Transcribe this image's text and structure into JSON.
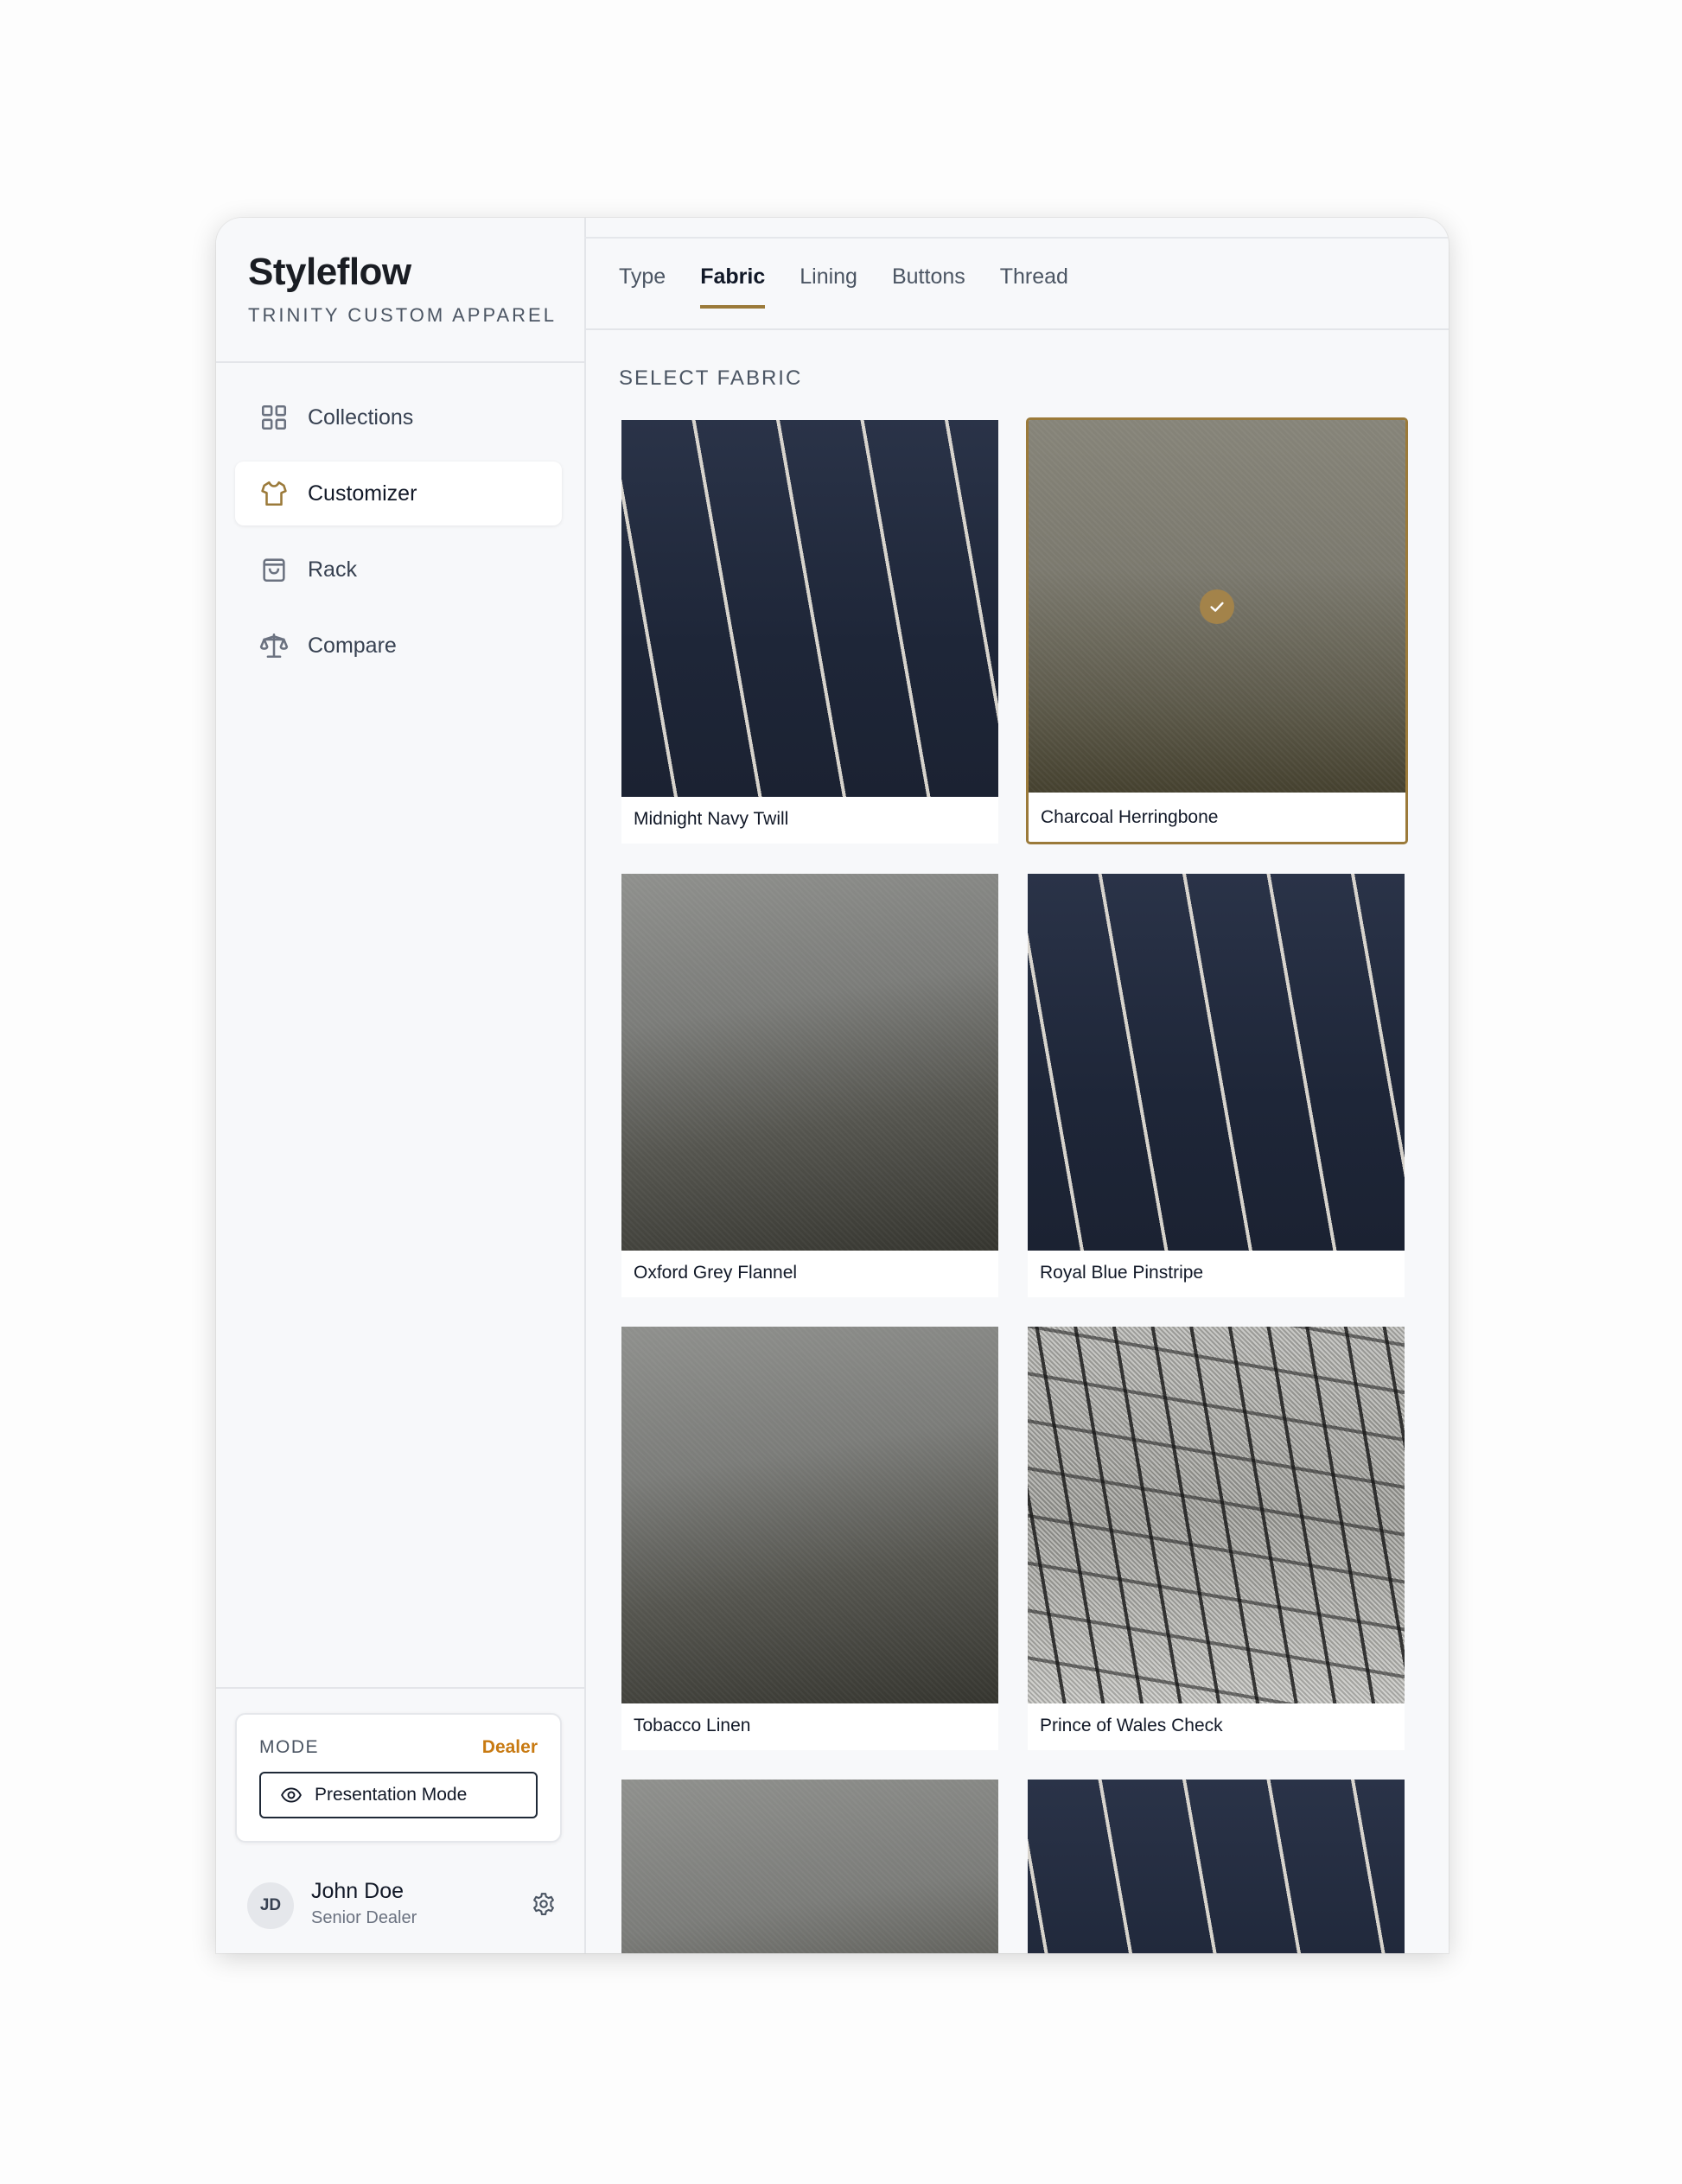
{
  "brand": {
    "title": "Styleflow",
    "subtitle": "TRINITY CUSTOM APPAREL"
  },
  "sidebar": {
    "items": [
      {
        "label": "Collections",
        "icon": "grid-icon",
        "active": false
      },
      {
        "label": "Customizer",
        "icon": "shirt-icon",
        "active": true
      },
      {
        "label": "Rack",
        "icon": "shopping-bag-icon",
        "active": false
      },
      {
        "label": "Compare",
        "icon": "scale-icon",
        "active": false
      }
    ]
  },
  "mode": {
    "label": "MODE",
    "value": "Dealer",
    "button_label": "Presentation Mode",
    "button_icon": "eye-icon"
  },
  "user": {
    "initials": "JD",
    "name": "John Doe",
    "role": "Senior Dealer",
    "settings_icon": "gear-icon"
  },
  "tabs": [
    {
      "label": "Type",
      "active": false
    },
    {
      "label": "Fabric",
      "active": true
    },
    {
      "label": "Lining",
      "active": false
    },
    {
      "label": "Buttons",
      "active": false
    },
    {
      "label": "Thread",
      "active": false
    }
  ],
  "section_title": "SELECT FABRIC",
  "fabrics": [
    {
      "name": "Midnight Navy Twill",
      "pattern": "pinstripe",
      "selected": false
    },
    {
      "name": "Charcoal Herringbone",
      "pattern": "charcoal",
      "selected": true
    },
    {
      "name": "Oxford Grey Flannel",
      "pattern": "flannel",
      "selected": false
    },
    {
      "name": "Royal Blue Pinstripe",
      "pattern": "pinstripe",
      "selected": false
    },
    {
      "name": "Tobacco Linen",
      "pattern": "flannel",
      "selected": false
    },
    {
      "name": "Prince of Wales Check",
      "pattern": "check",
      "selected": false
    },
    {
      "name": "",
      "pattern": "flannel",
      "selected": false
    },
    {
      "name": "",
      "pattern": "pinstripe",
      "selected": false
    }
  ],
  "colors": {
    "accent": "#9b7a3a",
    "mode_value": "#c87a12"
  }
}
